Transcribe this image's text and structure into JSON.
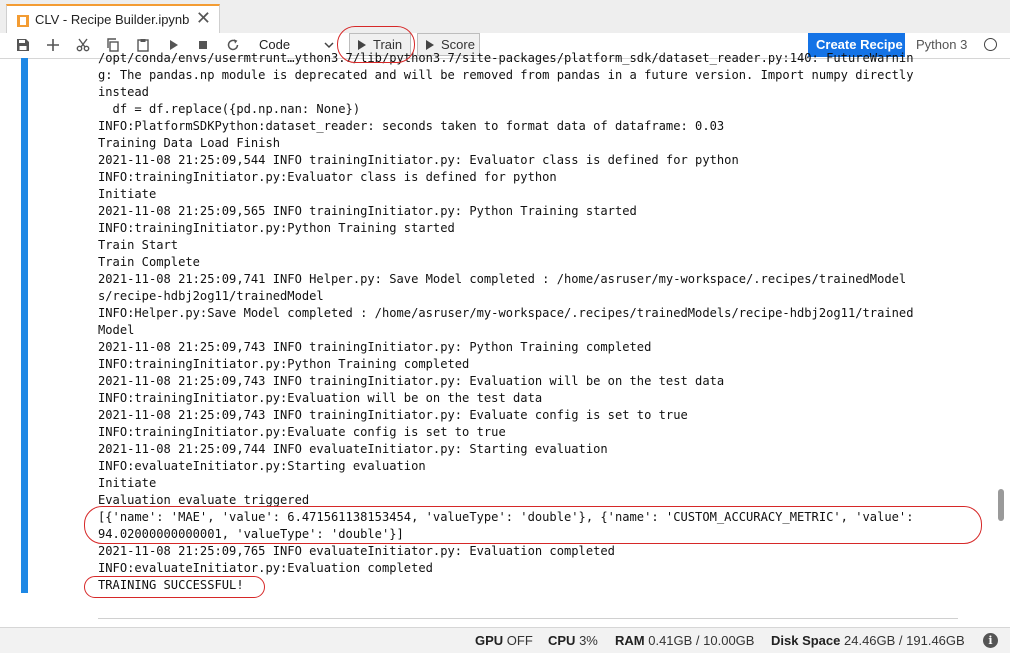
{
  "tab": {
    "title": "CLV - Recipe Builder.ipynb",
    "close_glyph": "✕",
    "icon": "jupyter-notebook-icon"
  },
  "toolbar": {
    "icons": [
      "save-icon",
      "add-cell-icon",
      "cut-icon",
      "copy-icon",
      "paste-icon",
      "run-icon",
      "stop-icon",
      "restart-icon"
    ],
    "cell_type": "Code",
    "train_label": "Train",
    "score_label": "Score",
    "create_recipe_label": "Create Recipe",
    "kernel_name": "Python 3"
  },
  "output_lines": [
    "/opt/conda/envs/usermtrunt…ython3.7/lib/python3.7/site-packages/platform_sdk/dataset_reader.py:140: FutureWarnin",
    "g: The pandas.np module is deprecated and will be removed from pandas in a future version. Import numpy directly",
    "instead",
    "  df = df.replace({pd.np.nan: None})",
    "INFO:PlatformSDKPython:dataset_reader: seconds taken to format data of dataframe: 0.03",
    "Training Data Load Finish",
    "2021-11-08 21:25:09,544 INFO trainingInitiator.py: Evaluator class is defined for python",
    "INFO:trainingInitiator.py:Evaluator class is defined for python",
    "Initiate",
    "2021-11-08 21:25:09,565 INFO trainingInitiator.py: Python Training started",
    "INFO:trainingInitiator.py:Python Training started",
    "Train Start",
    "Train Complete",
    "2021-11-08 21:25:09,741 INFO Helper.py: Save Model completed : /home/asruser/my-workspace/.recipes/trainedModel",
    "s/recipe-hdbj2og11/trainedModel",
    "INFO:Helper.py:Save Model completed : /home/asruser/my-workspace/.recipes/trainedModels/recipe-hdbj2og11/trained",
    "Model",
    "2021-11-08 21:25:09,743 INFO trainingInitiator.py: Python Training completed",
    "INFO:trainingInitiator.py:Python Training completed",
    "2021-11-08 21:25:09,743 INFO trainingInitiator.py: Evaluation will be on the test data",
    "INFO:trainingInitiator.py:Evaluation will be on the test data",
    "2021-11-08 21:25:09,743 INFO trainingInitiator.py: Evaluate config is set to true",
    "INFO:trainingInitiator.py:Evaluate config is set to true",
    "2021-11-08 21:25:09,744 INFO evaluateInitiator.py: Starting evaluation",
    "INFO:evaluateInitiator.py:Starting evaluation",
    "Initiate",
    "Evaluation evaluate triggered",
    "[{'name': 'MAE', 'value': 6.471561138153454, 'valueType': 'double'}, {'name': 'CUSTOM_ACCURACY_METRIC', 'value':",
    "94.02000000000001, 'valueType': 'double'}]",
    "2021-11-08 21:25:09,765 INFO evaluateInitiator.py: Evaluation completed",
    "INFO:evaluateInitiator.py:Evaluation completed",
    "TRAINING SUCCESSFUL!"
  ],
  "status_bar": {
    "gpu_label": "GPU",
    "gpu_value": "OFF",
    "cpu_label": "CPU",
    "cpu_value": "3%",
    "ram_label": "RAM",
    "ram_value": "0.41GB / 10.00GB",
    "disk_label": "Disk Space",
    "disk_value": "24.46GB / 191.46GB",
    "info_glyph": "i"
  },
  "colors": {
    "accent": "#1473e6",
    "cell_bar": "#1e88e5",
    "annotation": "#d62828",
    "tab_accent": "#f39c33"
  }
}
